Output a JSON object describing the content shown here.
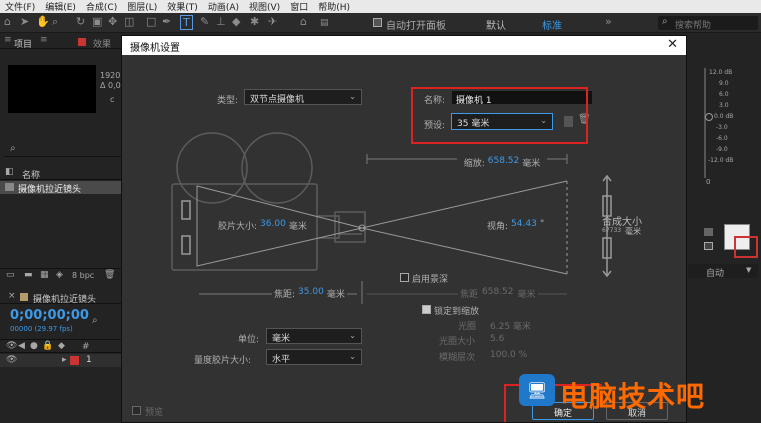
{
  "menubar": {
    "items": [
      "文件(F)",
      "编辑(E)",
      "合成(C)",
      "图层(L)",
      "效果(T)",
      "动画(A)",
      "视图(V)",
      "窗口",
      "帮助(H)"
    ]
  },
  "toolbar": {
    "auto_open_label": "自动打开面板",
    "workspace_default": "默认",
    "workspace_standard": "标准",
    "search_placeholder": "搜索帮助"
  },
  "left_panel": {
    "tab_project": "项目",
    "tab_effects_partial": "效果",
    "info_1920": "1920",
    "info_delta": "Δ 0,0",
    "info_c": "c",
    "col_name": "名称",
    "item_comp": "摄像机拉近镜头",
    "bpc": "8 bpc",
    "timeline_tab": "摄像机拉近镜头",
    "timecode": "0;00;00;00",
    "timecode_sub": "00000 (29.97 fps)",
    "layer_num": "1",
    "hash": "#"
  },
  "right_panel": {
    "levels": [
      "12.0 dB",
      "9.0",
      "6.0",
      "3.0",
      "0.0 dB",
      "-3.0",
      "-6.0",
      "-9.0",
      "-12.0 dB"
    ],
    "scale_0": "0",
    "auto_label": "自动"
  },
  "dialog": {
    "title": "摄像机设置",
    "type_label": "类型:",
    "type_value": "双节点摄像机",
    "name_label": "名称:",
    "name_value": "摄像机 1",
    "preset_label": "预设:",
    "preset_value": "35 毫米",
    "zoom_label": "缩放:",
    "zoom_value": "658.52",
    "zoom_unit": "毫米",
    "film_size_label": "胶片大小:",
    "film_size_value": "36.00",
    "film_size_unit": "毫米",
    "angle_label": "视角:",
    "angle_value": "54.43",
    "angle_unit": "°",
    "comp_size_label": "合成大小",
    "comp_size_value": "67733",
    "comp_size_unit": "毫米",
    "enable_dof_label": "启用景深",
    "focal_length_label": "焦距:",
    "focal_length_value": "35.00",
    "focal_length_unit": "毫米",
    "focus_dist_label": "焦距",
    "focus_dist_value": "658.52",
    "focus_dist_unit": "毫米",
    "lock_zoom_label": "锁定到缩放",
    "aperture_label": "光圈",
    "aperture_value": "6.25 毫米",
    "fstop_label": "光圈大小",
    "fstop_value": "5.6",
    "blur_label": "模糊层次",
    "blur_value": "100.0 %",
    "units_label": "单位:",
    "units_value": "毫米",
    "measure_label": "量度胶片大小:",
    "measure_value": "水平",
    "preview_label": "预览",
    "ok_label": "确定",
    "cancel_label": "取消"
  },
  "watermark": {
    "text": "电脑技术吧"
  },
  "colors": {
    "accent_blue": "#3d9ae8",
    "highlight_red": "#dd2222",
    "watermark_orange": "#ff6a00"
  }
}
